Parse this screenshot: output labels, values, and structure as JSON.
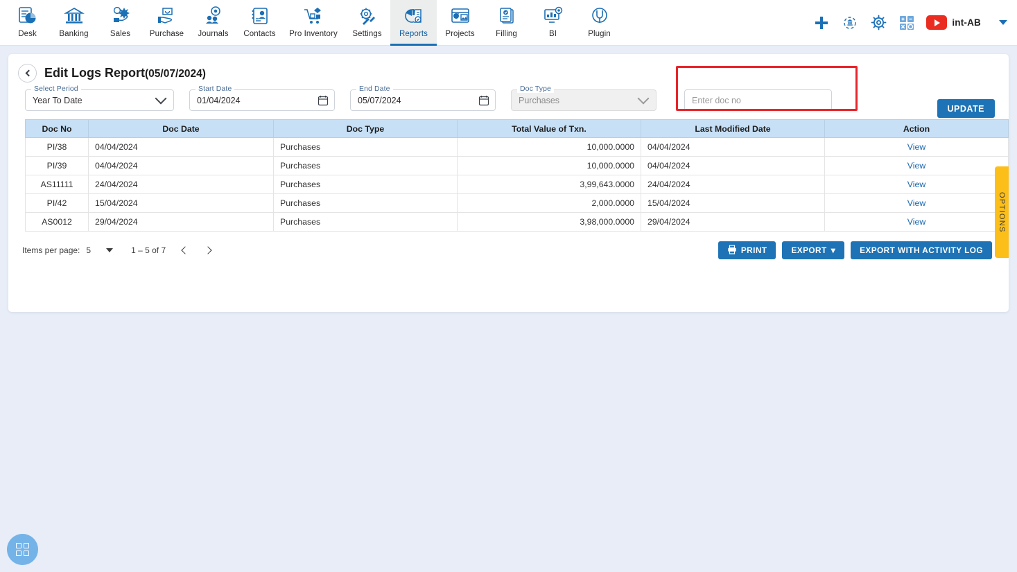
{
  "topnav": {
    "items": [
      {
        "label": "Desk",
        "icon": "desk-icon",
        "active": false
      },
      {
        "label": "Banking",
        "icon": "bank-icon",
        "active": false
      },
      {
        "label": "Sales",
        "icon": "sales-icon",
        "active": false
      },
      {
        "label": "Purchase",
        "icon": "purchase-icon",
        "active": false
      },
      {
        "label": "Journals",
        "icon": "journals-icon",
        "active": false
      },
      {
        "label": "Contacts",
        "icon": "contacts-icon",
        "active": false
      },
      {
        "label": "Pro Inventory",
        "icon": "inventory-icon",
        "active": false
      },
      {
        "label": "Settings",
        "icon": "settings-gear-wrench-icon",
        "active": false
      },
      {
        "label": "Reports",
        "icon": "reports-piechart-icon",
        "active": true
      },
      {
        "label": "Projects",
        "icon": "projects-icon",
        "active": false
      },
      {
        "label": "Filling",
        "icon": "filling-docs-icon",
        "active": false
      },
      {
        "label": "BI",
        "icon": "bi-monitor-icon",
        "active": false
      },
      {
        "label": "Plugin",
        "icon": "plugin-icon",
        "active": false
      }
    ],
    "right": {
      "add_icon": "plus-icon",
      "refresh_bank_icon": "bank-refresh-icon",
      "settings_icon": "gear-icon",
      "calculator_icon": "calculator-icon",
      "youtube_icon": "youtube-icon",
      "company": "int-AB",
      "dropdown_icon": "chevron-down-icon"
    }
  },
  "page": {
    "back_icon": "back-chevron-icon",
    "title": "Edit Logs Report",
    "title_suffix": "(05/07/2024)"
  },
  "filters": {
    "period": {
      "label": "Select Period",
      "value": "Year To Date",
      "icon": "chevron-down-icon"
    },
    "start_date": {
      "label": "Start Date",
      "value": "01/04/2024",
      "icon": "calendar-icon"
    },
    "end_date": {
      "label": "End Date",
      "value": "05/07/2024",
      "icon": "calendar-icon"
    },
    "doc_type": {
      "label": "Doc Type",
      "value": "Purchases",
      "icon": "chevron-down-icon"
    },
    "doc_no": {
      "placeholder": "Enter doc no",
      "value": ""
    },
    "update_label": "UPDATE",
    "highlight_color": "#e8252a"
  },
  "table": {
    "columns": [
      "Doc No",
      "Doc Date",
      "Doc Type",
      "Total Value of Txn.",
      "Last Modified Date",
      "Action"
    ],
    "rows": [
      {
        "doc_no": "PI/38",
        "doc_date": "04/04/2024",
        "doc_type": "Purchases",
        "total": "10,000.0000",
        "last_modified": "04/04/2024",
        "action": "View"
      },
      {
        "doc_no": "PI/39",
        "doc_date": "04/04/2024",
        "doc_type": "Purchases",
        "total": "10,000.0000",
        "last_modified": "04/04/2024",
        "action": "View"
      },
      {
        "doc_no": "AS11111",
        "doc_date": "24/04/2024",
        "doc_type": "Purchases",
        "total": "3,99,643.0000",
        "last_modified": "24/04/2024",
        "action": "View"
      },
      {
        "doc_no": "PI/42",
        "doc_date": "15/04/2024",
        "doc_type": "Purchases",
        "total": "2,000.0000",
        "last_modified": "15/04/2024",
        "action": "View"
      },
      {
        "doc_no": "AS0012",
        "doc_date": "29/04/2024",
        "doc_type": "Purchases",
        "total": "3,98,000.0000",
        "last_modified": "29/04/2024",
        "action": "View"
      }
    ]
  },
  "paginator": {
    "items_per_page_label": "Items per page:",
    "items_per_page_value": "5",
    "range_label": "1 – 5 of 7",
    "prev_icon": "chevron-left-icon",
    "next_icon": "chevron-right-icon"
  },
  "footer": {
    "print_label": "PRINT",
    "print_icon": "printer-icon",
    "export_label": "EXPORT",
    "export_caret": "▾",
    "export_activity_label": "EXPORT WITH ACTIVITY LOG"
  },
  "options_tab": {
    "label": "OPTIONS",
    "color": "#fcbf19"
  },
  "fab": {
    "icon": "grid-apps-icon"
  },
  "theme": {
    "accent_blue": "#1d73b5",
    "table_header_blue": "#c7e0f6",
    "page_bg": "#e8edf7",
    "link_blue": "#1765ad"
  }
}
